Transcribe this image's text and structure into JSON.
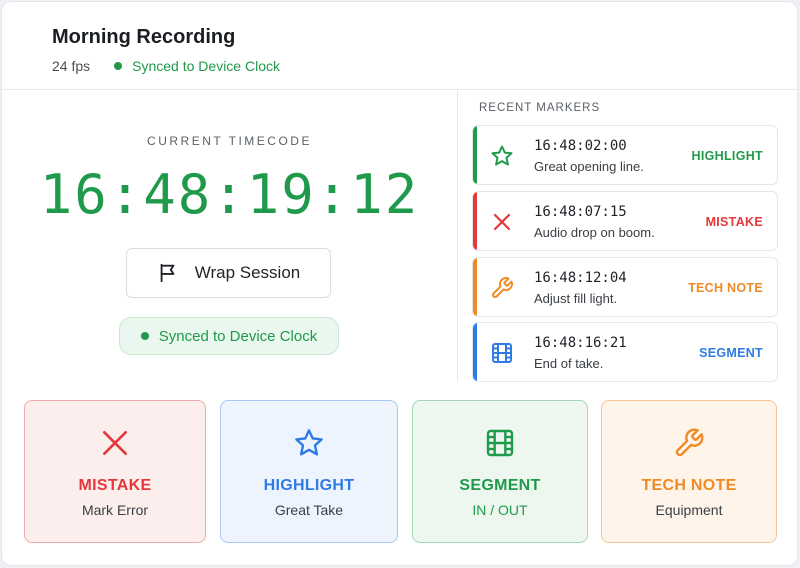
{
  "header": {
    "title": "Morning Recording",
    "fps": "24 fps",
    "sync_status": "Synced to Device Clock"
  },
  "timecode": {
    "label": "CURRENT TIMECODE",
    "value": "16:48:19:12"
  },
  "wrap_button": {
    "label": "Wrap Session",
    "icon": "flag-icon"
  },
  "sync_pill": {
    "label": "Synced to Device Clock"
  },
  "recent": {
    "title": "RECENT MARKERS",
    "markers": [
      {
        "time": "16:48:02:00",
        "note": "Great opening line.",
        "type": "HIGHLIGHT",
        "icon": "star-icon",
        "color": "#1f9a4a"
      },
      {
        "time": "16:48:07:15",
        "note": "Audio drop on boom.",
        "type": "MISTAKE",
        "icon": "x-icon",
        "color": "#e5383b"
      },
      {
        "time": "16:48:12:04",
        "note": "Adjust fill light.",
        "type": "TECH NOTE",
        "icon": "wrench-icon",
        "color": "#f08a24"
      },
      {
        "time": "16:48:16:21",
        "note": "End of take.",
        "type": "SEGMENT",
        "icon": "film-icon",
        "color": "#2f7be5"
      }
    ]
  },
  "actions": [
    {
      "label": "MISTAKE",
      "sub": "Mark Error",
      "icon": "x-icon",
      "color": "#e5383b",
      "bg": "#fdeeee",
      "border": "#f2a9aa"
    },
    {
      "label": "HIGHLIGHT",
      "sub": "Great Take",
      "icon": "star-icon",
      "color": "#2f7be5",
      "bg": "#eef4fd",
      "border": "#a9c7f2"
    },
    {
      "label": "SEGMENT",
      "sub": "IN / OUT",
      "icon": "film-icon",
      "color": "#1f9a4a",
      "bg": "#edf7f0",
      "border": "#a3d6b4"
    },
    {
      "label": "TECH NOTE",
      "sub": "Equipment",
      "icon": "wrench-icon",
      "color": "#f08a24",
      "bg": "#fef4ea",
      "border": "#f5c598"
    }
  ],
  "colors": {
    "accent_green": "#1f9a4a",
    "mistake_red": "#e5383b",
    "highlight_blue": "#2f7be5",
    "tech_orange": "#f08a24"
  }
}
